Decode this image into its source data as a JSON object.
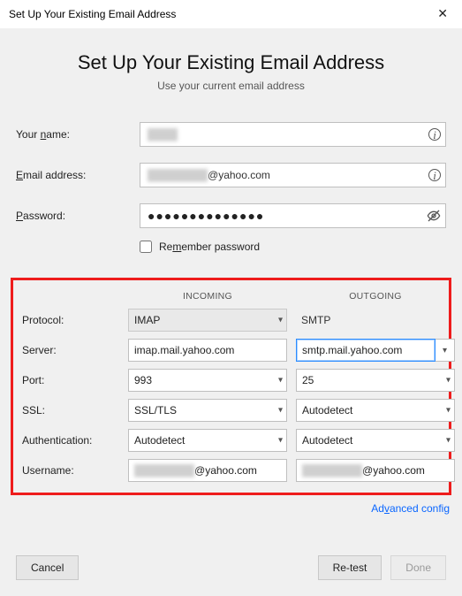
{
  "titlebar": {
    "title": "Set Up Your Existing Email Address"
  },
  "hero": {
    "title": "Set Up Your Existing Email Address",
    "subtitle": "Use your current email address"
  },
  "form": {
    "name_label": "Your name:",
    "name_value_hidden": "████",
    "email_label_prefix": "E",
    "email_label_rest": "mail address:",
    "email_hidden": "████████",
    "email_visible": "@yahoo.com",
    "password_label_prefix": "P",
    "password_label_rest": "assword:",
    "password_dots": "●●●●●●●●●●●●●●",
    "remember_prefix": "Re",
    "remember_ul": "m",
    "remember_rest": "ember password"
  },
  "server": {
    "headers": {
      "incoming": "INCOMING",
      "outgoing": "OUTGOING"
    },
    "rows": {
      "protocol": {
        "label": "Protocol:",
        "incoming": "IMAP",
        "outgoing": "SMTP"
      },
      "server": {
        "label": "Server:",
        "incoming": "imap.mail.yahoo.com",
        "outgoing": "smtp.mail.yahoo.com"
      },
      "port": {
        "label": "Port:",
        "incoming": "993",
        "outgoing": "25"
      },
      "ssl": {
        "label": "SSL:",
        "incoming": "SSL/TLS",
        "outgoing": "Autodetect"
      },
      "auth": {
        "label": "Authentication:",
        "incoming": "Autodetect",
        "outgoing": "Autodetect"
      },
      "user": {
        "label": "Username:",
        "hidden": "████████",
        "visible": "@yahoo.com"
      }
    }
  },
  "links": {
    "advanced_prefix": "Ad",
    "advanced_ul": "v",
    "advanced_rest": "anced config"
  },
  "buttons": {
    "cancel_ul": "C",
    "cancel_rest": "ancel",
    "retest_prefix": "Re-",
    "retest_ul": "t",
    "retest_rest": "est",
    "done_ul": "D",
    "done_rest": "one"
  }
}
